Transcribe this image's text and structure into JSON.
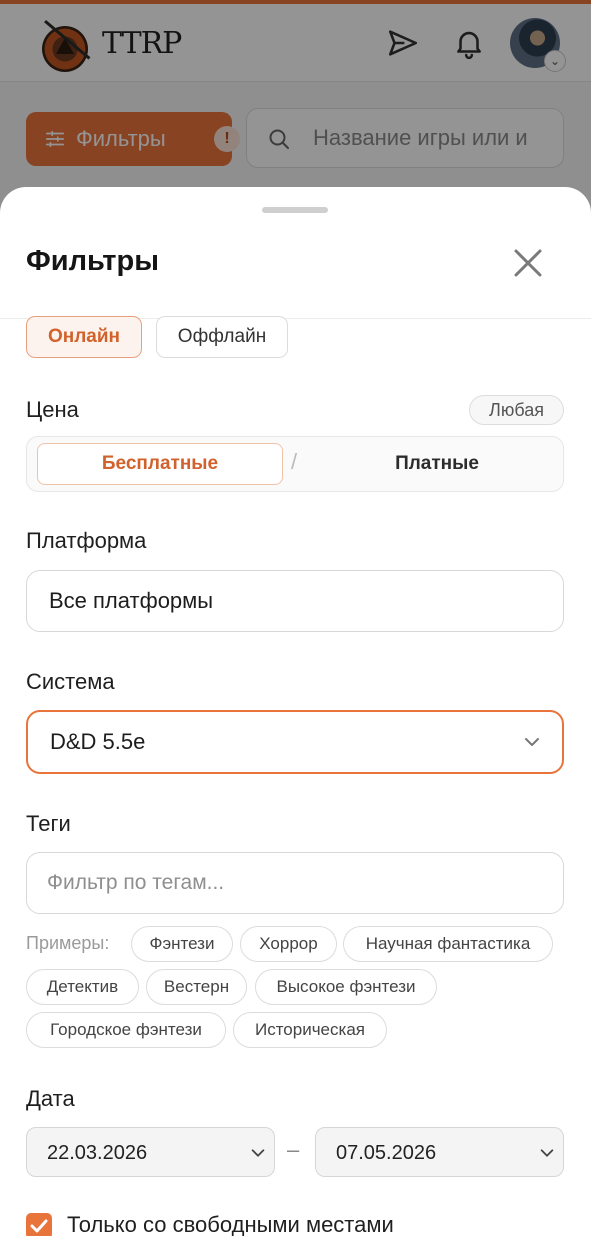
{
  "header": {
    "logo_text": "TTRP",
    "avatar_caret": "⌄"
  },
  "toolbar": {
    "filters_label": "Фильтры",
    "filters_badge": "!",
    "search_placeholder": "Название игры или и"
  },
  "sheet": {
    "title": "Фильтры",
    "format": {
      "online": "Онлайн",
      "offline": "Оффлайн",
      "selected": "online"
    },
    "price": {
      "label": "Цена",
      "any": "Любая",
      "free": "Бесплатные",
      "separator": "/",
      "paid": "Платные",
      "selected": "free"
    },
    "platform": {
      "label": "Платформа",
      "value": "Все платформы"
    },
    "system": {
      "label": "Система",
      "value": "D&D 5.5e"
    },
    "tags": {
      "label": "Теги",
      "placeholder": "Фильтр по тегам...",
      "examples_label": "Примеры:",
      "examples": [
        "Фэнтези",
        "Хоррор",
        "Научная фантастика",
        "Детектив",
        "Вестерн",
        "Высокое фэнтези",
        "Городское фэнтези",
        "Историческая"
      ]
    },
    "date": {
      "label": "Дата",
      "from": "22.03.2026",
      "separator": "–",
      "to": "07.05.2026"
    },
    "free_seats": {
      "label": "Только со свободными местами",
      "checked": true
    }
  },
  "colors": {
    "accent": "#e8743b",
    "accent_light": "#fdf3ee",
    "overlay": "rgba(0,0,0,0.42)"
  }
}
